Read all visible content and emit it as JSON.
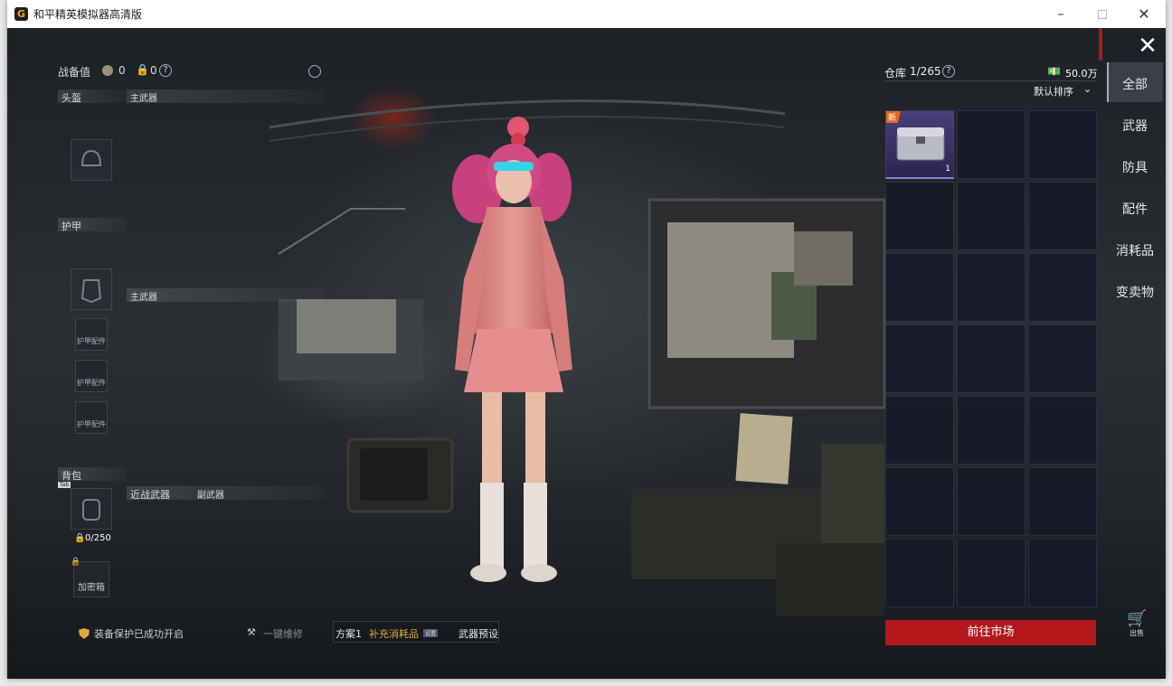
{
  "window": {
    "title": "和平精英模拟器高清版",
    "icon": "app-logo-icon"
  },
  "loadout": {
    "combat_label": "战备值",
    "combat_value": "0",
    "lock_value": "0",
    "help_icon": "?",
    "helmet_label": "头盔",
    "primary1_label": "主武器",
    "armor_label": "护甲",
    "primary2_label": "主武器",
    "armor_slots": [
      "护甲配件",
      "护甲配件",
      "护甲配件"
    ],
    "backpack_label": "背包",
    "backpack_tag": "Tab",
    "backpack_capacity": "0/250",
    "melee_label": "近战武器",
    "secondary_label": "副武器",
    "safe_box_label": "加密箱"
  },
  "bottom_bar": {
    "protection_text": "装备保护已成功开启",
    "repair_text": "一键维修",
    "plan_label": "方案1",
    "restock_label": "补充消耗品",
    "restock_tag": "设置",
    "preset_label": "武器预设"
  },
  "warehouse": {
    "label": "仓库",
    "count": "1/265",
    "help_icon": "?",
    "money": "50.0万",
    "sort_label": "默认排序",
    "item": {
      "badge": "新",
      "quantity": "1"
    },
    "market_button": "前往市场"
  },
  "categories": [
    "全部",
    "武器",
    "防具",
    "配件",
    "消耗品",
    "变卖物"
  ],
  "sell_label": "出售",
  "colors": {
    "market_red": "#b3191c",
    "active_tab": "#3a3f48",
    "new_badge": "#e06a1a",
    "item_bg": "#3a3365"
  }
}
